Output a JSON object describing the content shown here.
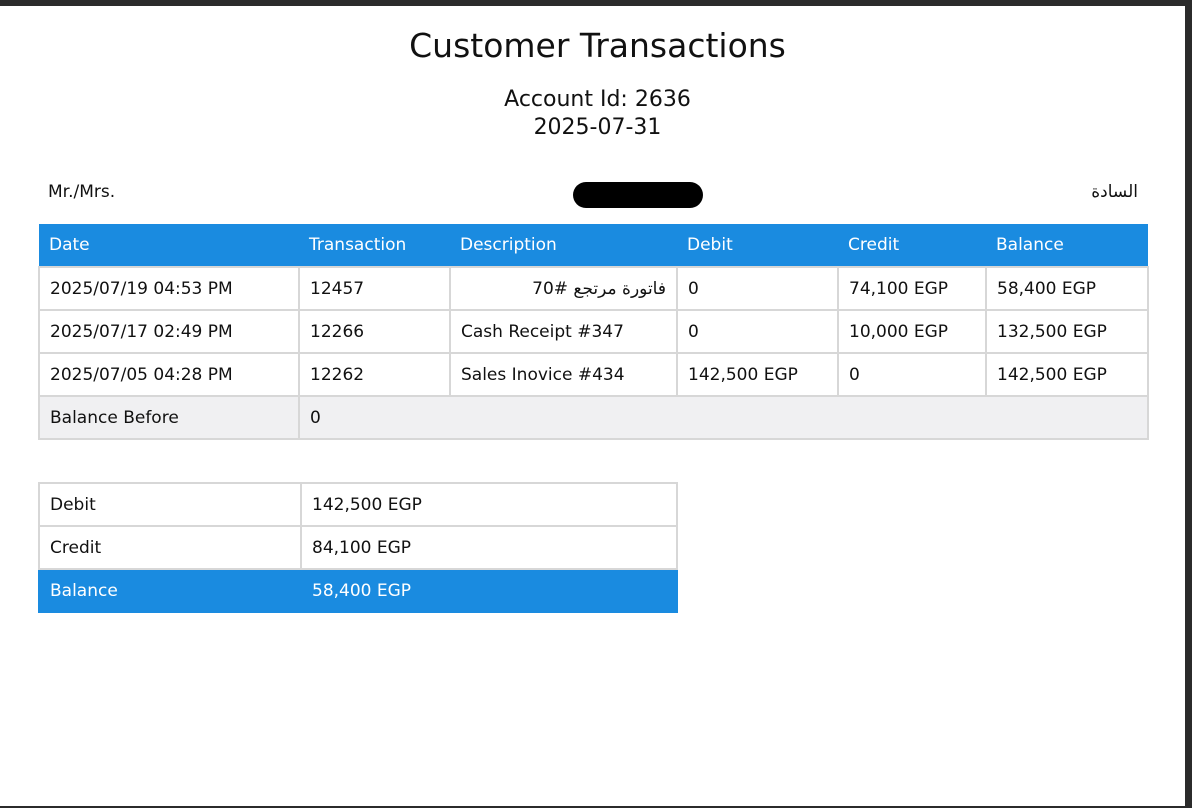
{
  "title": "Customer Transactions",
  "account": {
    "label": "Account Id: 2636",
    "date": "2025-07-31"
  },
  "customer": {
    "label_en": "Mr./Mrs.",
    "label_ar": "السادة"
  },
  "transactions": {
    "headers": {
      "date": "Date",
      "transaction": "Transaction",
      "description": "Description",
      "debit": "Debit",
      "credit": "Credit",
      "balance": "Balance"
    },
    "rows": [
      {
        "date": "2025/07/19 04:53 PM",
        "transaction": "12457",
        "description": "فاتورة مرتجع #70",
        "debit": "0",
        "credit": "74,100 EGP",
        "balance": "58,400 EGP"
      },
      {
        "date": "2025/07/17 02:49 PM",
        "transaction": "12266",
        "description": "Cash Receipt #347",
        "debit": "0",
        "credit": "10,000 EGP",
        "balance": "132,500 EGP"
      },
      {
        "date": "2025/07/05 04:28 PM",
        "transaction": "12262",
        "description": "Sales Inovice #434",
        "debit": "142,500 EGP",
        "credit": "0",
        "balance": "142,500 EGP"
      }
    ],
    "balance_before": {
      "label": "Balance Before",
      "value": "0"
    }
  },
  "summary": {
    "debit": {
      "label": "Debit",
      "value": "142,500 EGP"
    },
    "credit": {
      "label": "Credit",
      "value": "84,100 EGP"
    },
    "balance": {
      "label": "Balance",
      "value": "58,400 EGP"
    }
  },
  "colors": {
    "accent": "#1a8be0"
  }
}
